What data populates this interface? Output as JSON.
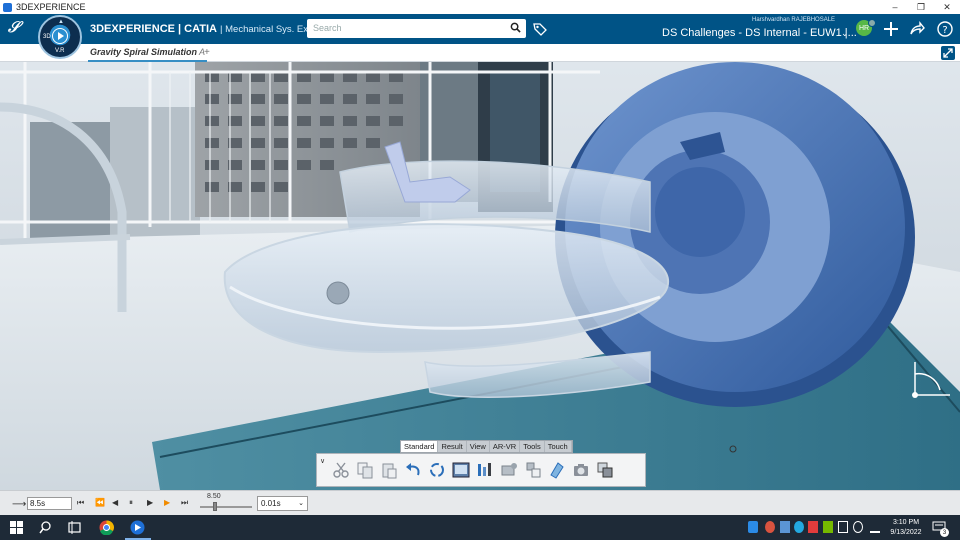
{
  "window": {
    "title": "3DEXPERIENCE",
    "controls": [
      "minimize",
      "restore",
      "close"
    ]
  },
  "header": {
    "brand_main": "3DEXPERIENCE | CATIA",
    "brand_sub": "| Mechanical Sys. Experie...",
    "compass_version": "V.R",
    "compass_label": "3D",
    "search": {
      "placeholder": "Search",
      "value": ""
    },
    "user_name": "Harshvardhan RAJEBHOSALE",
    "avatar_initials": "HR",
    "tenant": "DS Challenges - DS Internal - EUW1 |...",
    "colors": {
      "bar": "#005386",
      "avatar": "#57b847"
    },
    "icons": [
      "search-icon",
      "tag-icon",
      "add-icon",
      "share-icon",
      "help-icon"
    ]
  },
  "tabs": {
    "active": "Gravity Spiral Simulation",
    "active_suffix": "A",
    "add_label": "+"
  },
  "toolbar": {
    "tabs": [
      "Standard",
      "Result",
      "View",
      "AR-VR",
      "Tools",
      "Touch"
    ],
    "active_tab": "Standard",
    "expand_label": "∨",
    "tools": [
      "cut-icon",
      "copy-icon",
      "paste-icon",
      "undo-icon",
      "update-icon",
      "display-icon",
      "analysis-icon",
      "sensors-icon",
      "measure-icon",
      "section-icon",
      "capture-icon",
      "compare-icon"
    ]
  },
  "player": {
    "current_time": "8.5s",
    "scale_value": "8.50",
    "step": "0.01s",
    "buttons": [
      "jump-to-start",
      "step-back",
      "previous",
      "pause",
      "next",
      "play",
      "jump-to-end"
    ]
  },
  "taskbar": {
    "time": "3:10 PM",
    "date": "9/13/2022",
    "notification_count": "3"
  }
}
